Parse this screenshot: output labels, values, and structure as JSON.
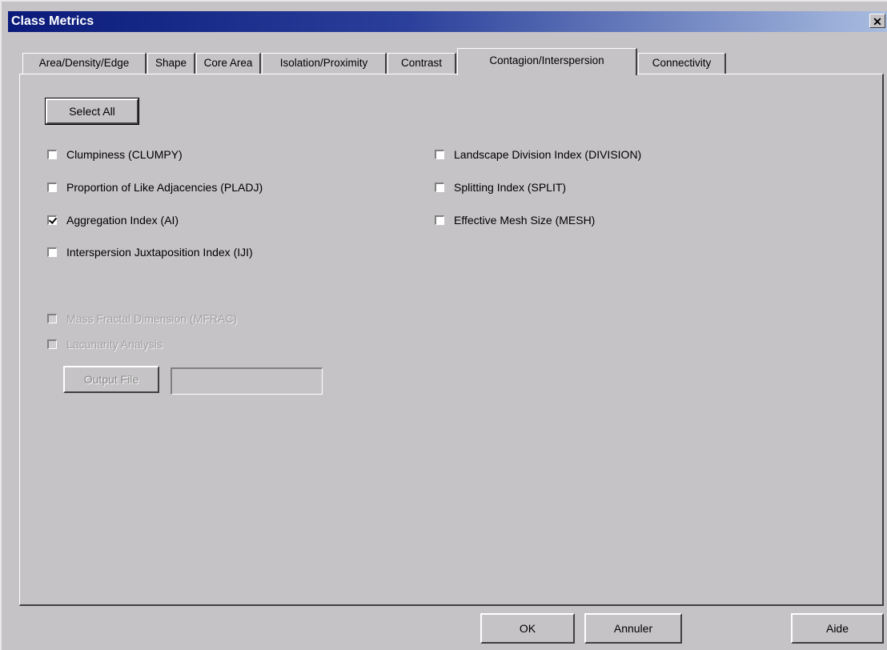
{
  "window": {
    "title": "Class Metrics",
    "close_glyph": "✕"
  },
  "tabs": [
    {
      "label": "Area/Density/Edge",
      "active": false
    },
    {
      "label": "Shape",
      "active": false
    },
    {
      "label": "Core Area",
      "active": false
    },
    {
      "label": "Isolation/Proximity",
      "active": false
    },
    {
      "label": "Contrast",
      "active": false
    },
    {
      "label": "Contagion/Interspersion",
      "active": true
    },
    {
      "label": "Connectivity",
      "active": false
    }
  ],
  "panel": {
    "select_all_label": "Select All",
    "left_metrics": [
      {
        "label": "Clumpiness (CLUMPY)",
        "checked": false
      },
      {
        "label": "Proportion of Like Adjacencies  (PLADJ)",
        "checked": false
      },
      {
        "label": "Aggregation Index (AI)",
        "checked": true
      },
      {
        "label": "Interspersion  Juxtaposition Index (IJI)",
        "checked": false
      }
    ],
    "right_metrics": [
      {
        "label": "Landscape Division Index  (DIVISION)",
        "checked": false
      },
      {
        "label": "Splitting Index  (SPLIT)",
        "checked": false
      },
      {
        "label": "Effective Mesh Size  (MESH)",
        "checked": false
      }
    ],
    "disabled_metrics": [
      {
        "label": "Mass Fractal Dimension  (MFRAC)",
        "checked": false
      },
      {
        "label": "Lacunarity Analysis",
        "checked": false
      }
    ],
    "output_file_label": "Output File",
    "output_file_value": ""
  },
  "footer": {
    "ok_label": "OK",
    "cancel_label": "Annuler",
    "help_label": "Aide"
  },
  "colors": {
    "face": "#c6c3c6",
    "title_start": "#0a1a7a",
    "title_end": "#a9bde0"
  }
}
